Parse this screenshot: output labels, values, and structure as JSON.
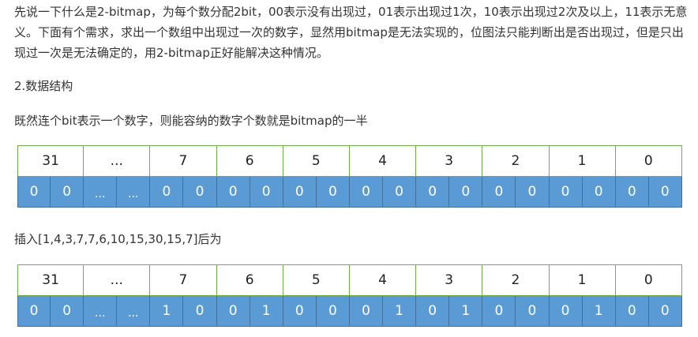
{
  "article": {
    "intro": "先说一下什么是2-bitmap，为每个数分配2bit，00表示没有出现过，01表示出现过1次，10表示出现过2次及以上，11表示无意义。下面有个需求，求出一个数组中出现过一次的数字，显然用bitmap是无法实现的，位图法只能判断出是否出现过，但是只出现过一次是无法确定的，用2-bitmap正好能解决这种情况。",
    "section_title": "2.数据结构",
    "description": "既然连个bit表示一个数字，则能容纳的数字个数就是bitmap的一半",
    "insert_text": "插入[1,4,3,7,7,6,10,15,30,15,7]后为"
  },
  "tables": {
    "before": {
      "indices": [
        "31",
        "...",
        "7",
        "6",
        "5",
        "4",
        "3",
        "2",
        "1",
        "0"
      ],
      "bits": [
        "0",
        "0",
        "...",
        "...",
        "0",
        "0",
        "0",
        "0",
        "0",
        "0",
        "0",
        "0",
        "0",
        "0",
        "0",
        "0",
        "0",
        "0",
        "0",
        "0"
      ]
    },
    "after": {
      "indices": [
        "31",
        "...",
        "7",
        "6",
        "5",
        "4",
        "3",
        "2",
        "1",
        "0"
      ],
      "bits": [
        "0",
        "0",
        "...",
        "...",
        "1",
        "0",
        "0",
        "1",
        "0",
        "0",
        "0",
        "1",
        "0",
        "1",
        "0",
        "0",
        "0",
        "1",
        "0",
        "0"
      ]
    }
  },
  "colors": {
    "index_border": "#70ad47",
    "bit_fill": "#5b9bd5",
    "bit_border": "#41719c",
    "text": "#333333"
  }
}
